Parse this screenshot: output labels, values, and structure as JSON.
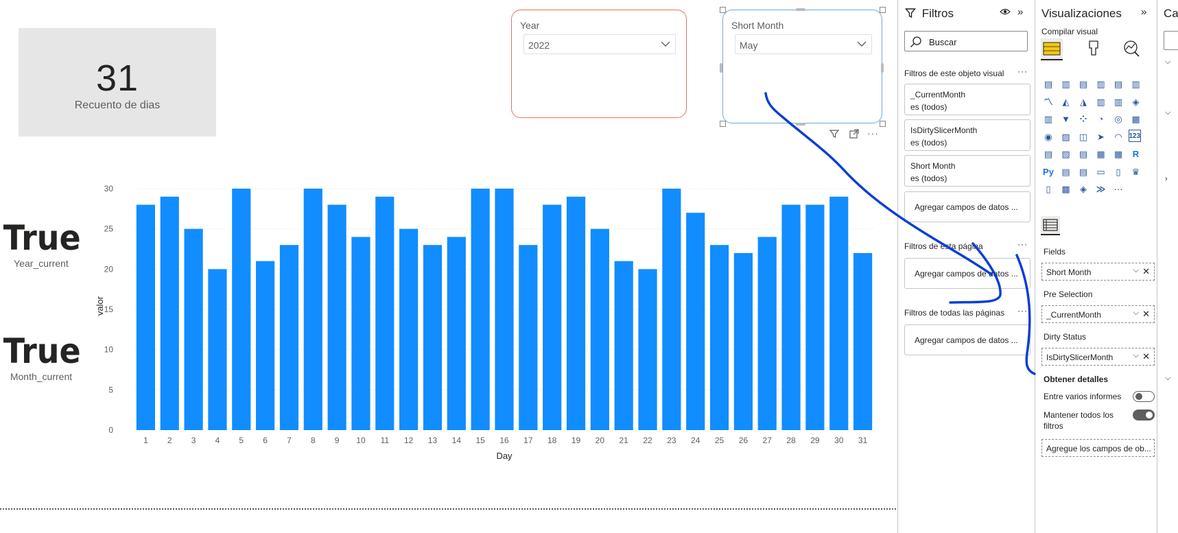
{
  "card": {
    "value": "31",
    "label": "Recuento de dias"
  },
  "year_current": {
    "value": "True",
    "label": "Year_current"
  },
  "month_current": {
    "value": "True",
    "label": "Month_current"
  },
  "slicer_year": {
    "title": "Year",
    "selected": "2022"
  },
  "slicer_month": {
    "title": "Short Month",
    "selected": "May"
  },
  "chart_data": {
    "type": "bar",
    "categories": [
      "1",
      "2",
      "3",
      "4",
      "5",
      "6",
      "7",
      "8",
      "9",
      "10",
      "11",
      "12",
      "13",
      "14",
      "15",
      "16",
      "17",
      "18",
      "19",
      "20",
      "21",
      "22",
      "23",
      "24",
      "25",
      "26",
      "27",
      "28",
      "29",
      "30",
      "31"
    ],
    "values": [
      28,
      29,
      25,
      20,
      30,
      21,
      23,
      30,
      28,
      24,
      29,
      25,
      23,
      24,
      30,
      30,
      23,
      28,
      29,
      25,
      21,
      20,
      30,
      27,
      23,
      22,
      24,
      28,
      28,
      29,
      22
    ],
    "xlabel": "Day",
    "ylabel": "valor",
    "ylim": [
      0,
      30
    ],
    "yticks": [
      0,
      5,
      10,
      15,
      20,
      25,
      30
    ],
    "color": "#118dff",
    "grid": true
  },
  "filters": {
    "title": "Filtros",
    "search_placeholder": "Buscar",
    "visual_section": "Filtros de este objeto visual",
    "visual_filters": [
      {
        "field": "_CurrentMonth",
        "state": "es (todos)"
      },
      {
        "field": "IsDirtySlicerMonth",
        "state": "es (todos)"
      },
      {
        "field": "Short Month",
        "state": "es (todos)"
      }
    ],
    "add_fields": "Agregar campos de datos ...",
    "page_section": "Filtros de esta página",
    "all_pages_section": "Filtros de todas las páginas",
    "more": "···"
  },
  "visualizations": {
    "title": "Visualizaciones",
    "build_label": "Compilar visual",
    "fields_label": "Fields",
    "fields_value": "Short Month",
    "preselection_label": "Pre Selection",
    "preselection_value": "_CurrentMonth",
    "dirty_label": "Dirty Status",
    "dirty_value": "IsDirtySlicerMonth",
    "drill_label": "Obtener detalles",
    "cross_report_label": "Entre varios informes",
    "keep_filters_label": "Mantener todos los filtros",
    "add_drill_fields": "Agregue los campos de ob...",
    "py_label": "Py",
    "r_label": "R",
    "num_label": "123",
    "more": "···"
  },
  "data_pane": {
    "title_partial": "Ca"
  },
  "colors": {
    "accent": "#118dff",
    "selected_slicer_border": "#e3735e",
    "annotation": "#0a3fd6"
  }
}
